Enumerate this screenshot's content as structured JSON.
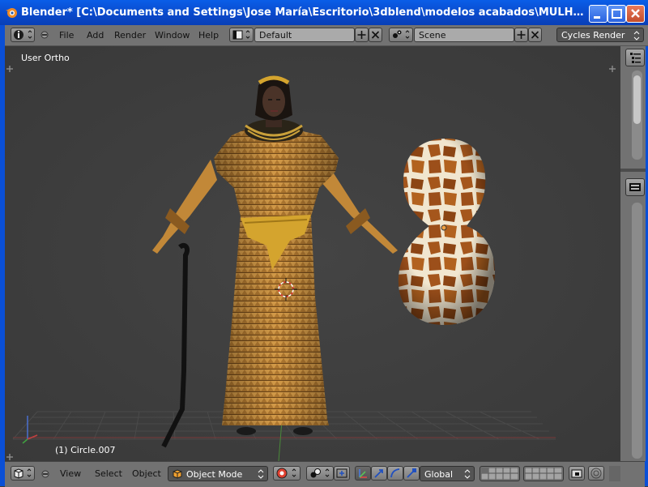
{
  "window": {
    "title": "Blender* [C:\\Documents and Settings\\Jose María\\Escritorio\\3dblend\\modelos acabados\\MULHORAND\\clerigos\\c..."
  },
  "header": {
    "menus": [
      "File",
      "Add",
      "Render",
      "Window",
      "Help"
    ],
    "screen_layout": "Default",
    "scene": "Scene",
    "render_engine": "Cycles Render"
  },
  "viewport": {
    "view_label": "User Ortho",
    "object_label": "(1) Circle.007"
  },
  "footer": {
    "menus": [
      "View",
      "Select",
      "Object"
    ],
    "mode": "Object Mode",
    "orientation": "Global"
  }
}
